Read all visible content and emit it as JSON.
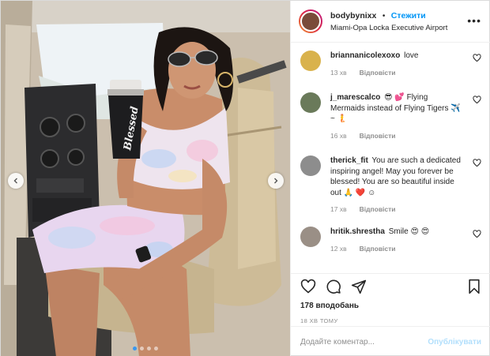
{
  "photo": {
    "shaker_text": "Blessed",
    "carousel_count": 4,
    "carousel_active": 0
  },
  "header": {
    "username": "bodybynixx",
    "separator": "•",
    "follow_label": "Стежити",
    "location": "Miami-Opa Locka Executive Airport",
    "more_icon": "more-dots-icon"
  },
  "comments": [
    {
      "username": "briannanicolexoxo",
      "text": "love",
      "time": "13 хв",
      "reply_label": "Відповісти",
      "avatar_color": "#d9b24c"
    },
    {
      "username": "j_marescalco",
      "text": "😎 💕 Flying Mermaids instead of Flying Tigers ✈️ ~ 🧜",
      "time": "16 хв",
      "reply_label": "Відповісти",
      "avatar_color": "#6a7a5a"
    },
    {
      "username": "therick_fit",
      "text": "You are such a dedicated inspiring angel! May you forever be blessed! You are so beautiful inside out 🙏 ❤️ ☺",
      "time": "17 хв",
      "reply_label": "Відповісти",
      "avatar_color": "#8d8d8d"
    },
    {
      "username": "hritik.shrestha",
      "text": "Smile 😍 😍",
      "time": "12 хв",
      "reply_label": "Відповісти",
      "avatar_color": "#9a8f86"
    }
  ],
  "actions": {
    "likes": "178 вподобань",
    "timestamp": "18 ХВ ТОМУ"
  },
  "add_comment": {
    "placeholder": "Додайте коментар...",
    "post_label": "Опублікувати"
  },
  "colors": {
    "accent": "#0095f6",
    "post_disabled": "#b2dffc",
    "active_dot": "#3897f0"
  }
}
